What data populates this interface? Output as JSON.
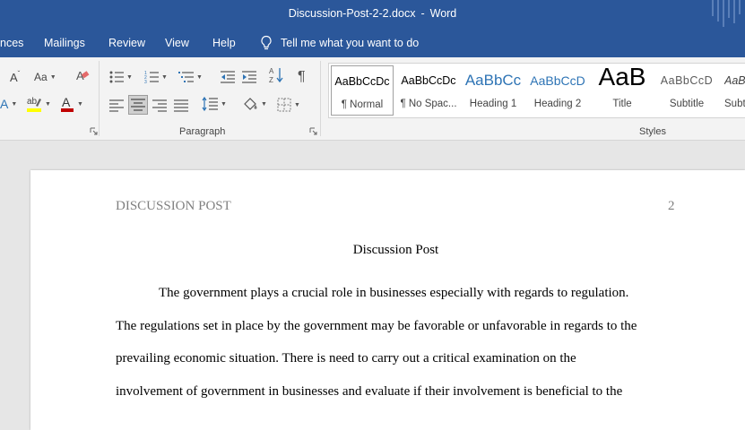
{
  "window": {
    "file_name": "Discussion-Post-2-2.docx",
    "separator": "-",
    "app_name": "Word"
  },
  "menu": {
    "tabs": [
      "nces",
      "Mailings",
      "Review",
      "View",
      "Help"
    ],
    "tell_me": "Tell me what you want to do"
  },
  "ribbon": {
    "font_case_label": "Aa",
    "paragraph_group_label": "Paragraph",
    "styles_group_label": "Styles",
    "styles": [
      {
        "preview": "AaBbCcDc",
        "name": "¶ Normal"
      },
      {
        "preview": "AaBbCcDc",
        "name": "¶ No Spac..."
      },
      {
        "preview": "AaBbCc",
        "name": "Heading 1"
      },
      {
        "preview": "AaBbCcD",
        "name": "Heading 2"
      },
      {
        "preview": "AaB",
        "name": "Title"
      },
      {
        "preview": "AaBbCcD",
        "name": "Subtitle"
      },
      {
        "preview": "AaBb",
        "name": "Subtl"
      }
    ]
  },
  "document": {
    "running_head": "DISCUSSION POST",
    "page_number": "2",
    "title": "Discussion Post",
    "lines": [
      "The government plays a crucial role in businesses especially with regards to regulation.",
      "The regulations set in place by the government may be favorable or unfavorable in regards to the",
      "prevailing economic situation. There is need to carry out a critical examination on the",
      "involvement of government in businesses and evaluate if their involvement is beneficial to the"
    ]
  },
  "colors": {
    "title_bar": "#2b579a",
    "ribbon": "#f3f3f3",
    "canvas": "#e6e6e6",
    "heading_blue": "#2e74b5",
    "font_color_red": "#c00000",
    "highlight_yellow": "#ffff00"
  }
}
